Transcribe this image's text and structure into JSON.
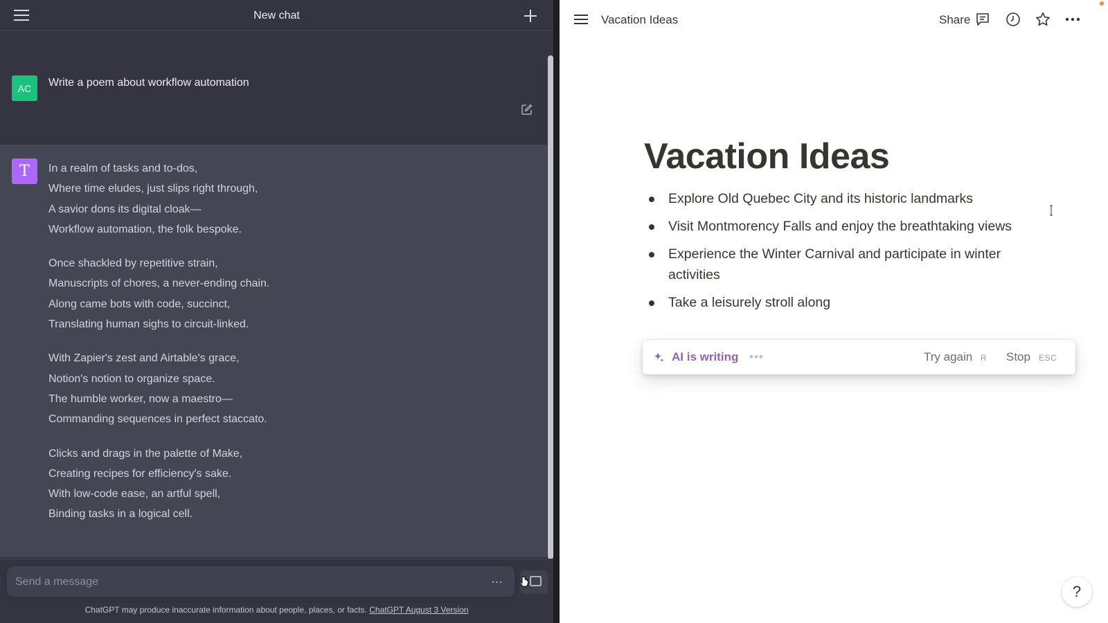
{
  "chat": {
    "title": "New chat",
    "user": {
      "avatar_initials": "AC",
      "message": "Write a poem about workflow automation"
    },
    "assistant": {
      "avatar_letter": "T",
      "stanzas": [
        [
          "In a realm of tasks and to-dos,",
          "Where time eludes, just slips right through,",
          "A savior dons its digital cloak—",
          "Workflow automation, the folk bespoke."
        ],
        [
          "Once shackled by repetitive strain,",
          "Manuscripts of chores, a never-ending chain.",
          "Along came bots with code, succinct,",
          "Translating human sighs to circuit-linked."
        ],
        [
          "With Zapier's zest and Airtable's grace,",
          "Notion's notion to organize space.",
          "The humble worker, now a maestro—",
          "Commanding sequences in perfect staccato."
        ],
        [
          "Clicks and drags in the palette of Make,",
          "Creating recipes for efficiency's sake.",
          "With low-code ease, an artful spell,",
          "Binding tasks in a logical cell."
        ]
      ]
    },
    "composer": {
      "placeholder": "Send a message",
      "more_label": "⋯"
    },
    "disclaimer": {
      "text": "ChatGPT may produce inaccurate information about people, places, or facts. ",
      "link": "ChatGPT August 3 Version"
    }
  },
  "notion": {
    "breadcrumb_title": "Vacation Ideas",
    "share_label": "Share",
    "page_title": "Vacation Ideas",
    "bullets": [
      "Explore Old Quebec City and its historic landmarks",
      "Visit Montmorency Falls and enjoy the breathtaking views",
      "Experience the Winter Carnival and participate in winter activities",
      "Take a leisurely stroll along"
    ],
    "ai_bar": {
      "status": "AI is writing",
      "dots": "•••",
      "try_again": "Try again",
      "try_again_key": "R",
      "stop": "Stop",
      "stop_key": "ESC"
    },
    "help_label": "?"
  },
  "colors": {
    "chat_bg": "#343541",
    "assistant_bg": "#444654",
    "user_avatar": "#19c37d",
    "assistant_avatar": "#ab68ff",
    "ai_purple": "#9065b0"
  },
  "icons": {
    "chat_menu": "hamburger-icon",
    "new_chat": "plus-icon",
    "edit": "edit-icon",
    "notion_menu": "hamburger-icon",
    "comments": "comment-icon",
    "history": "clock-icon",
    "favorite": "star-icon",
    "more": "more-icon",
    "ai": "sparkle-icon"
  }
}
